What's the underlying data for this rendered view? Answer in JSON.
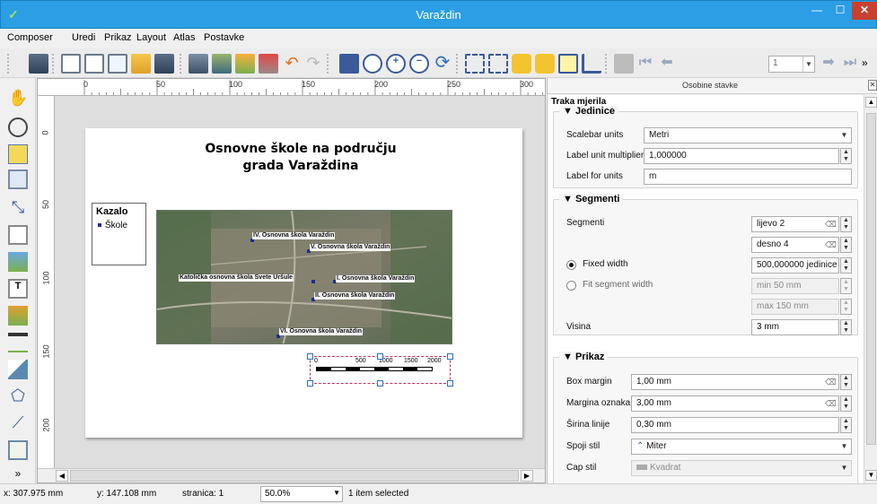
{
  "window": {
    "title": "Varaždin",
    "app_icon": "qgis-icon"
  },
  "menu": [
    {
      "label": "Composer"
    },
    {
      "label": "Uredi"
    },
    {
      "label": "Prikaz"
    },
    {
      "label": "Layout"
    },
    {
      "label": "Atlas"
    },
    {
      "label": "Postavke"
    }
  ],
  "toolbar": {
    "page_number": "1",
    "overflow": "»",
    "icons": [
      "save-icon",
      "new-composer-icon",
      "duplicate-composer-icon",
      "composer-manager-icon",
      "open-template-icon",
      "save-template-icon",
      "print-icon",
      "export-image-icon",
      "export-svg-icon",
      "export-pdf-icon",
      "undo-icon",
      "redo-icon",
      "zoom-full-icon",
      "zoom-100-icon",
      "zoom-in-icon",
      "zoom-out-icon",
      "refresh-icon",
      "group-icon",
      "ungroup-icon",
      "lock-icon",
      "unlock-icon",
      "raise-icon",
      "align-icon",
      "atlas-preview-icon",
      "first-feature-icon",
      "prev-feature-icon",
      "next-feature-icon",
      "last-feature-icon"
    ]
  },
  "ruler": {
    "h_labels": [
      "0",
      "50",
      "100",
      "150",
      "200",
      "250",
      "300"
    ],
    "v_labels": [
      "0",
      "50",
      "100",
      "150",
      "200"
    ]
  },
  "layout": {
    "title_line1": "Osnovne škole na području",
    "title_line2": "grada Varaždina",
    "legend_title": "Kazalo",
    "legend_item": "Škole",
    "map_labels": [
      "IV. Osnovna škola Varaždin",
      "V. Osnovna škola Varaždin",
      "Katolička osnovna škola Svete Uršule",
      "I. Osnovna škola Varaždin",
      "II. Osnovna škola Varaždin",
      "VI. Osnovna škola Varaždin"
    ],
    "scalebar_labels": [
      "0",
      "500",
      "1000",
      "1500",
      "2000"
    ]
  },
  "panel": {
    "header": "Osobine stavke",
    "item_title": "Traka mjerila",
    "jedinice": {
      "title": "Jedinice",
      "scalebar_units_label": "Scalebar units",
      "scalebar_units_value": "Metri",
      "multiplier_label": "Label unit multiplier",
      "multiplier_value": "1,000000",
      "label_for_units_label": "Label for units",
      "label_for_units_value": "m"
    },
    "segmenti": {
      "title": "Segmenti",
      "segments_label": "Segmenti",
      "left_value": "lijevo 2",
      "right_value": "desno 4",
      "fixed_width_label": "Fixed width",
      "fixed_width_value": "500,000000 jedinice",
      "fit_width_label": "Fit segment width",
      "min_value": "min 50 mm",
      "max_value": "max 150 mm",
      "height_label": "Visina",
      "height_value": "3 mm"
    },
    "prikaz": {
      "title": "Prikaz",
      "box_margin_label": "Box margin",
      "box_margin_value": "1,00 mm",
      "label_margin_label": "Margina oznaka",
      "label_margin_value": "3,00 mm",
      "line_width_label": "Širina linije",
      "line_width_value": "0,30 mm",
      "join_style_label": "Spoji stil",
      "join_style_value": "Miter",
      "cap_style_label": "Cap stil",
      "cap_style_value": "Kvadrat"
    }
  },
  "status": {
    "x": "x: 307.975 mm",
    "y": "y: 147.108 mm",
    "page": "stranica: 1",
    "zoom": "50.0%",
    "selection": "1 item selected"
  },
  "colors": {
    "titlebar": "#2b9ee6",
    "close_button": "#c84030",
    "selection_dash": "#c0305a"
  }
}
